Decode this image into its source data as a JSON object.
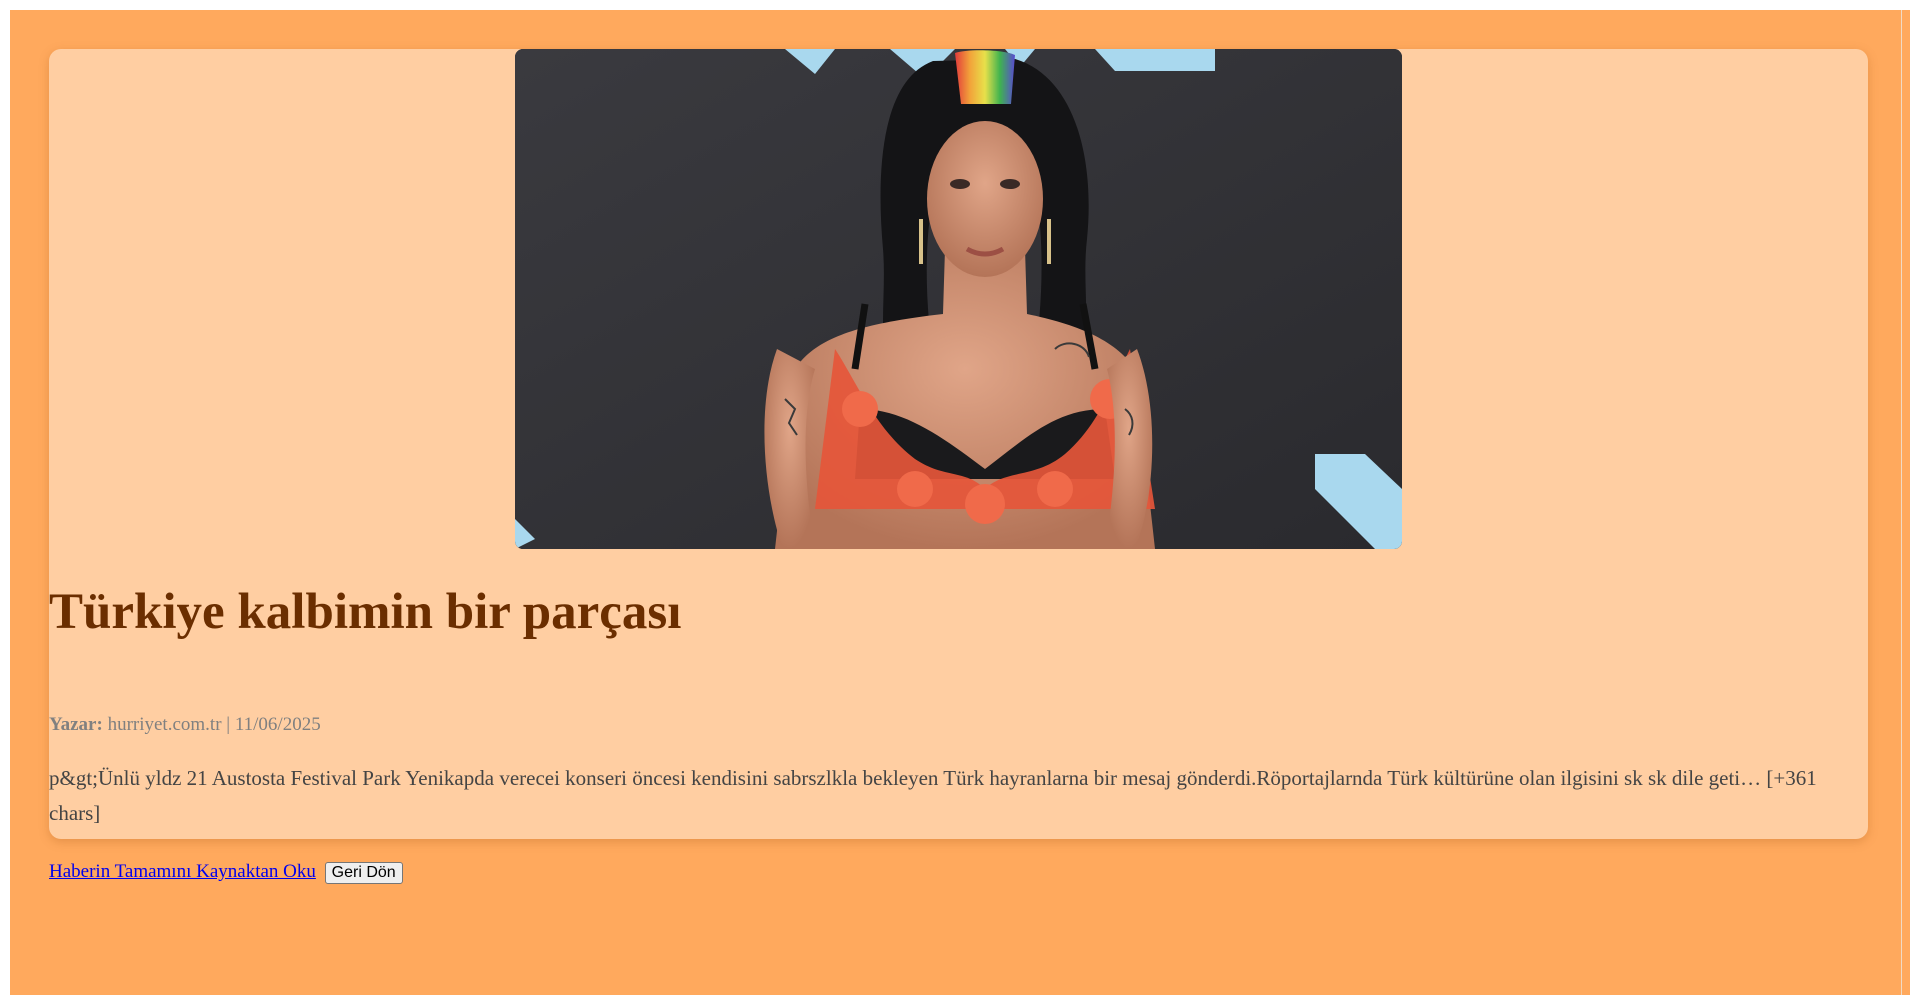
{
  "article": {
    "image_alt": "Haber görseli",
    "title": "Türkiye kalbimin bir parçası",
    "author_label": "Yazar:",
    "author": "hurriyet.com.tr",
    "separator": "|",
    "date": "11/06/2025",
    "content": "p&gt;Ünlü yldz 21 Austosta Festival Park Yenikapda verecei konseri öncesi kendisini sabrszlkla bekleyen Türk hayranlarna bir mesaj gönderdi.Röportajlarnda Türk kültürüne olan ilgisini sk sk dile geti… [+361 chars]"
  },
  "actions": {
    "source_link_label": "Haberin Tamamını Kaynaktan Oku",
    "back_button_label": "Geri Dön"
  },
  "colors": {
    "page_background": "#ffa95d",
    "card_background": "#ffcea2",
    "title": "#6b2e00",
    "meta": "#808080",
    "body": "#444444",
    "link": "#0000ee"
  }
}
